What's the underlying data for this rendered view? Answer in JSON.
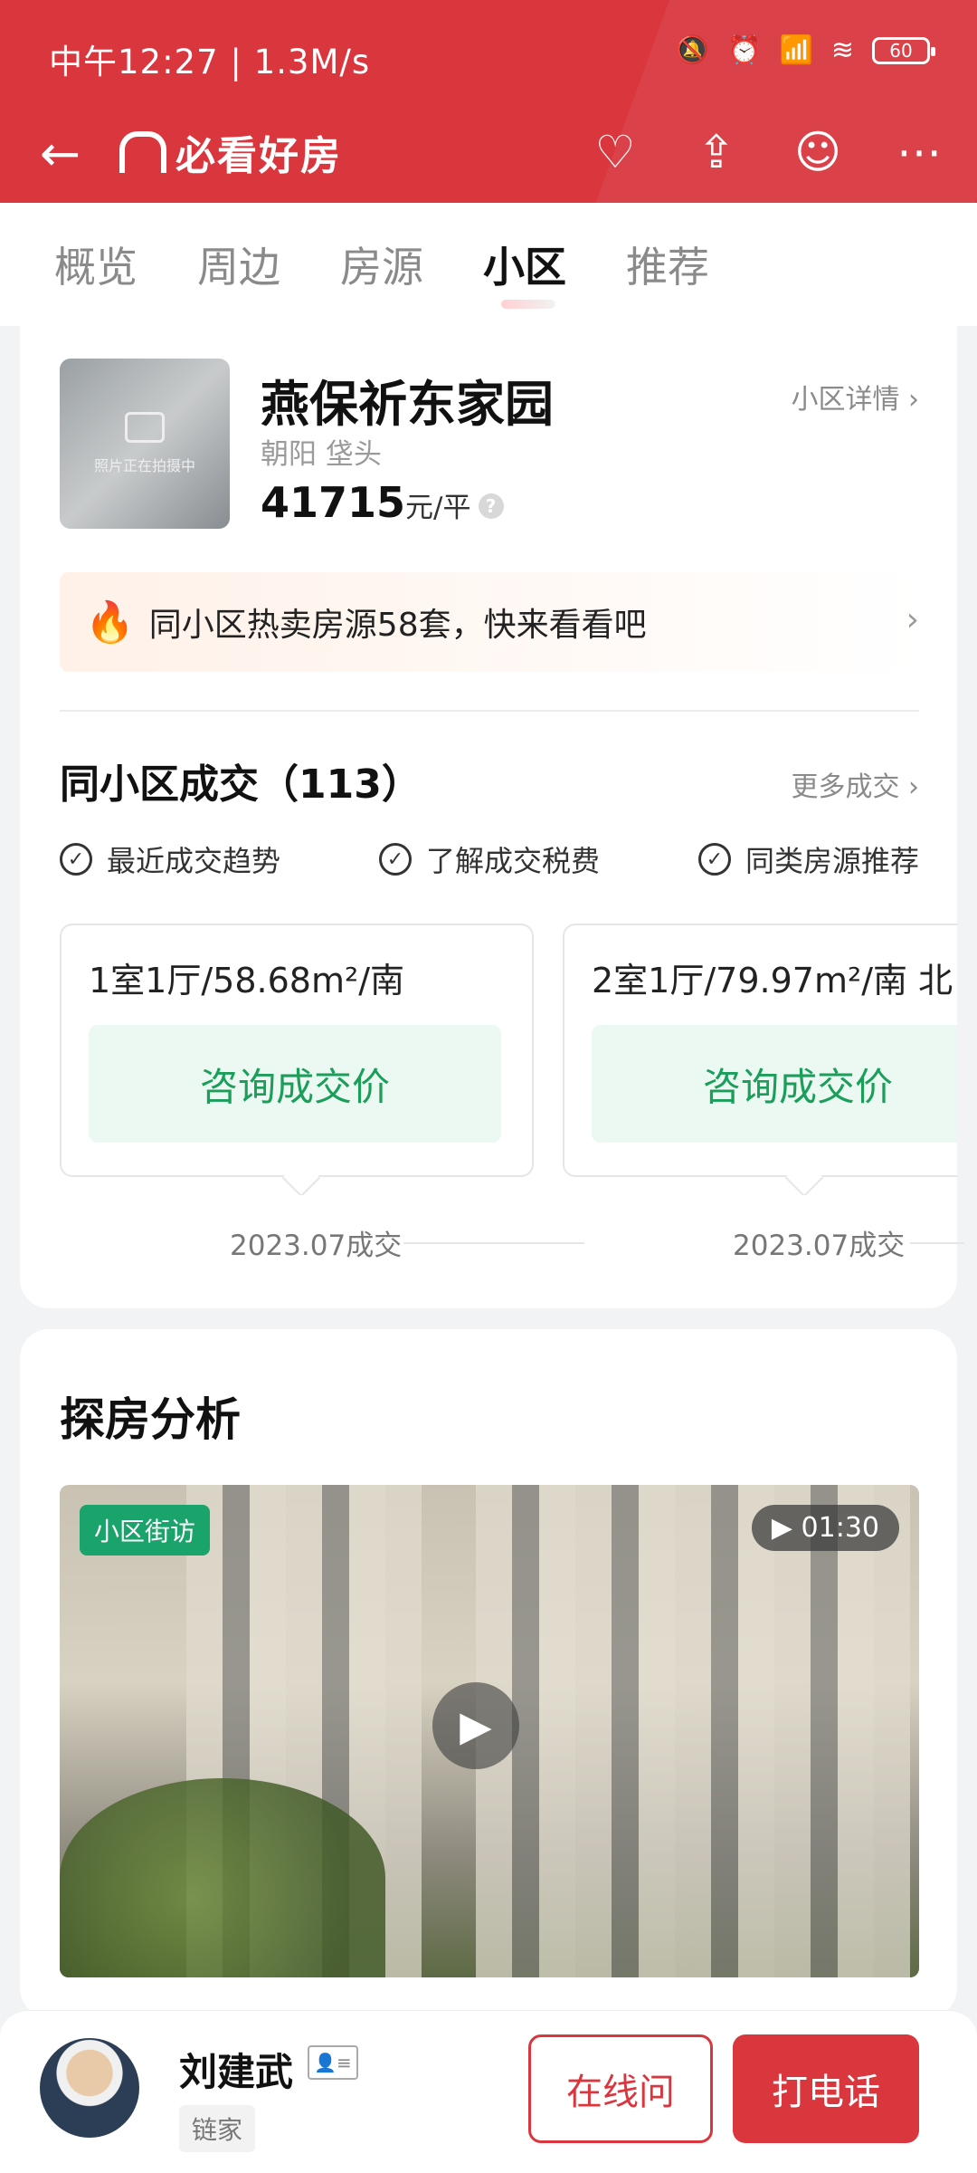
{
  "status_bar": {
    "time": "中午12:27 | 1.3M/s",
    "battery": "60"
  },
  "header": {
    "logo_text": "必看好房",
    "icons": [
      "back-arrow-icon",
      "heart-icon",
      "share-icon",
      "message-icon",
      "more-icon"
    ]
  },
  "tabs": [
    {
      "label": "概览"
    },
    {
      "label": "周边"
    },
    {
      "label": "房源"
    },
    {
      "label": "小区",
      "active": true
    },
    {
      "label": "推荐"
    }
  ],
  "community": {
    "photo_caption": "照片正在拍摄中",
    "name": "燕保祈东家园",
    "detail_link": "小区详情",
    "area": "朝阳 垡头",
    "price": "41715",
    "price_unit": "元/平",
    "hot_listing_text": "同小区热卖房源58套，快来看看吧"
  },
  "deals": {
    "title": "同小区成交（113）",
    "more_link": "更多成交",
    "chips": [
      "最近成交趋势",
      "了解成交税费",
      "同类房源推荐"
    ],
    "items": [
      {
        "title": "1室1厅/58.68m²/南",
        "button": "咨询成交价",
        "date": "2023.07成交"
      },
      {
        "title": "2室1厅/79.97m²/南 北",
        "button": "咨询成交价",
        "date": "2023.07成交"
      }
    ]
  },
  "analysis": {
    "title": "探房分析",
    "video_tag": "小区街访",
    "video_duration": "01:30"
  },
  "agent": {
    "name": "刘建武",
    "company": "链家",
    "online_button": "在线问",
    "call_button": "打电话"
  },
  "colors": {
    "brand_red": "#d9363e",
    "green_text": "#1a9e5a",
    "green_tag": "#1aa36a"
  }
}
